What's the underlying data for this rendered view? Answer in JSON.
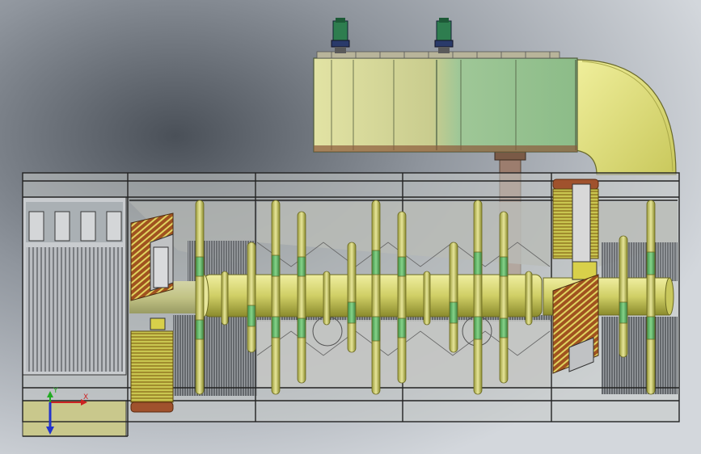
{
  "viewport": {
    "background_colors": [
      "#cdd2d8",
      "#8a9098",
      "#5e646c"
    ]
  },
  "triad": {
    "x_label": "X",
    "y_label": "Y",
    "x_color": "#cc2222",
    "y_color": "#22aa22",
    "z_color": "#2233cc"
  },
  "colors": {
    "pipe": "#d4d46a",
    "pipe_dark": "#8a8a2a",
    "green_band": "#5cb85c",
    "duct_green": "#8fbf8a",
    "duct_khaki": "#cfd08a",
    "copper": "#a0522d",
    "motor": "#2e7d4f",
    "frame_line": "#2a2a2a"
  }
}
